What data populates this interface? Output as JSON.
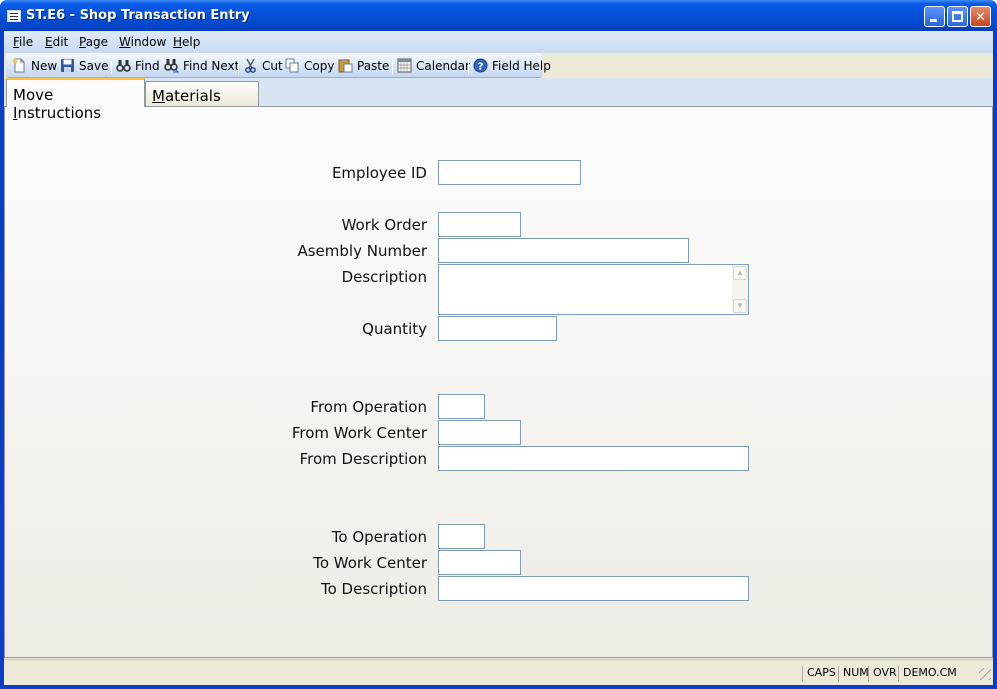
{
  "window": {
    "title": "ST.E6 - Shop Transaction Entry",
    "minimize_glyph": "",
    "maximize_glyph": "",
    "close_glyph": "✕"
  },
  "menu": {
    "items": [
      {
        "key": "F",
        "rest": "ile"
      },
      {
        "key": "E",
        "rest": "dit"
      },
      {
        "key": "P",
        "rest": "age"
      },
      {
        "key": "W",
        "rest": "indow"
      },
      {
        "key": "H",
        "rest": "elp"
      }
    ]
  },
  "toolbar": {
    "new": "New",
    "save": "Save",
    "find": "Find",
    "find_next": "Find Next",
    "cut": "Cut",
    "copy": "Copy",
    "paste": "Paste",
    "calendar": "Calendar",
    "field_help": "Field Help"
  },
  "tabs": {
    "move_instructions": {
      "pre": "Move ",
      "key": "I",
      "rest": "nstructions"
    },
    "materials_used": {
      "pre": "",
      "key": "M",
      "rest": "aterials Used"
    }
  },
  "form": {
    "employee_id": {
      "label": "Employee ID",
      "value": ""
    },
    "work_order": {
      "label": "Work Order",
      "value": ""
    },
    "assembly_number": {
      "label": "Asembly Number",
      "value": ""
    },
    "description": {
      "label": "Description",
      "value": ""
    },
    "quantity": {
      "label": "Quantity",
      "value": ""
    },
    "from_operation": {
      "label": "From Operation",
      "value": ""
    },
    "from_work_center": {
      "label": "From Work Center",
      "value": ""
    },
    "from_description": {
      "label": "From Description",
      "value": ""
    },
    "to_operation": {
      "label": "To Operation",
      "value": ""
    },
    "to_work_center": {
      "label": "To Work Center",
      "value": ""
    },
    "to_description": {
      "label": "To Description",
      "value": ""
    }
  },
  "status": {
    "caps": "CAPS",
    "num": "NUM",
    "ovr": "OVR",
    "account": "DEMO.CM"
  },
  "colors": {
    "titlebar": "#0450d8",
    "frame": "#0a3ec8",
    "tab_highlight": "#f5c242",
    "input_border": "#7f9db9"
  }
}
